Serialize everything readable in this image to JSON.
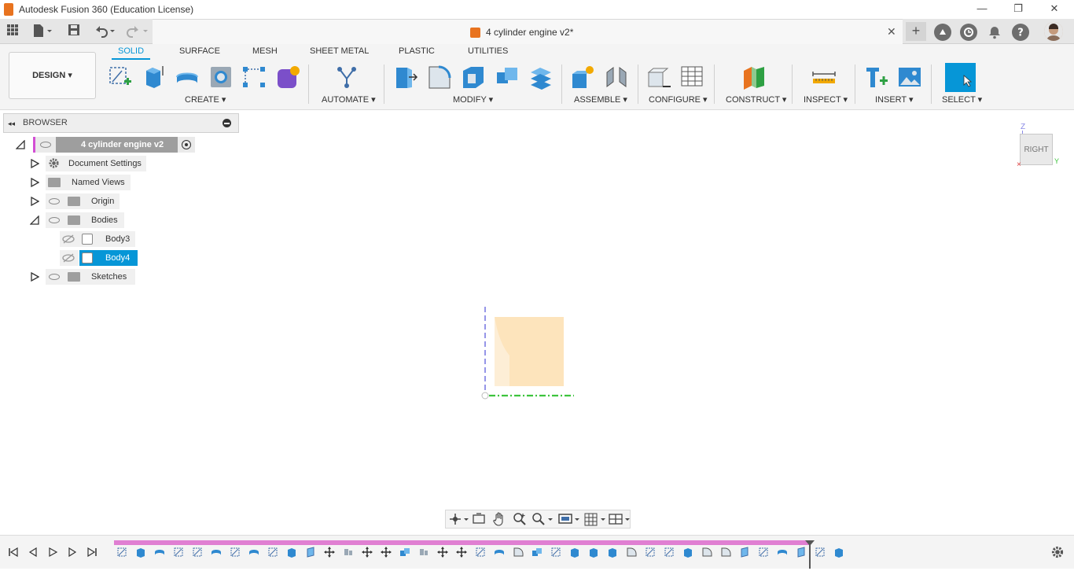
{
  "window": {
    "title": "Autodesk Fusion 360 (Education License)",
    "minimize": "—",
    "restore": "❐",
    "close": "✕"
  },
  "document": {
    "tab_name": "4 cylinder engine v2*",
    "close": "✕",
    "new_tab": "+"
  },
  "workspace": {
    "label": "DESIGN ▾"
  },
  "ribbon": {
    "tabs": [
      "SOLID",
      "SURFACE",
      "MESH",
      "SHEET METAL",
      "PLASTIC",
      "UTILITIES"
    ],
    "active_tab": "SOLID",
    "groups": {
      "create": "CREATE ▾",
      "automate": "AUTOMATE ▾",
      "modify": "MODIFY ▾",
      "assemble": "ASSEMBLE ▾",
      "configure": "CONFIGURE ▾",
      "construct": "CONSTRUCT ▾",
      "inspect": "INSPECT ▾",
      "insert": "INSERT ▾",
      "select": "SELECT ▾"
    }
  },
  "browser": {
    "title": "BROWSER",
    "root": "4 cylinder engine v2",
    "items": [
      "Document Settings",
      "Named Views",
      "Origin",
      "Bodies",
      "Body3",
      "Body4",
      "Sketches"
    ]
  },
  "viewcube": {
    "face": "RIGHT",
    "z_axis": "Z",
    "y_axis": "Y"
  },
  "colors": {
    "accent": "#0696d7",
    "body_fill": "#fde4bc",
    "timeline_track": "#e07fd2",
    "axis_green": "#3ec43e",
    "axis_blue": "#8a8ae6"
  }
}
